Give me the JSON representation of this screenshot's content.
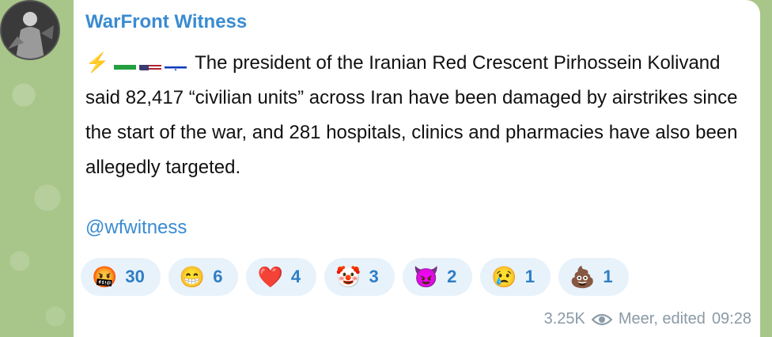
{
  "post": {
    "channel_name": "WarFront Witness",
    "message_text": "The president of the Iranian Red Crescent Pirhossein Kolivand said 82,417 “civilian units” across Iran have been damaged by airstrikes since the start of the war, and 281 hospitals, clinics and pharmacies have also been allegedly targeted.",
    "link": "@wfwitness",
    "views": "3.25K",
    "author_edited": "Meer, edited",
    "time": "09:28",
    "prefix_icons": [
      "lightning-icon",
      "iran-flag-icon",
      "us-flag-icon",
      "israel-flag-icon"
    ]
  },
  "reactions": [
    {
      "emoji": "🤬",
      "count": "30"
    },
    {
      "emoji": "😁",
      "count": "6"
    },
    {
      "emoji": "❤️",
      "count": "4"
    },
    {
      "emoji": "🤡",
      "count": "3"
    },
    {
      "emoji": "😈",
      "count": "2"
    },
    {
      "emoji": "😢",
      "count": "1"
    },
    {
      "emoji": "💩",
      "count": "1"
    }
  ],
  "colors": {
    "accent": "#3a8bd1",
    "reaction_bg": "#e7f2fb",
    "wallpaper": "#a9c68a"
  }
}
